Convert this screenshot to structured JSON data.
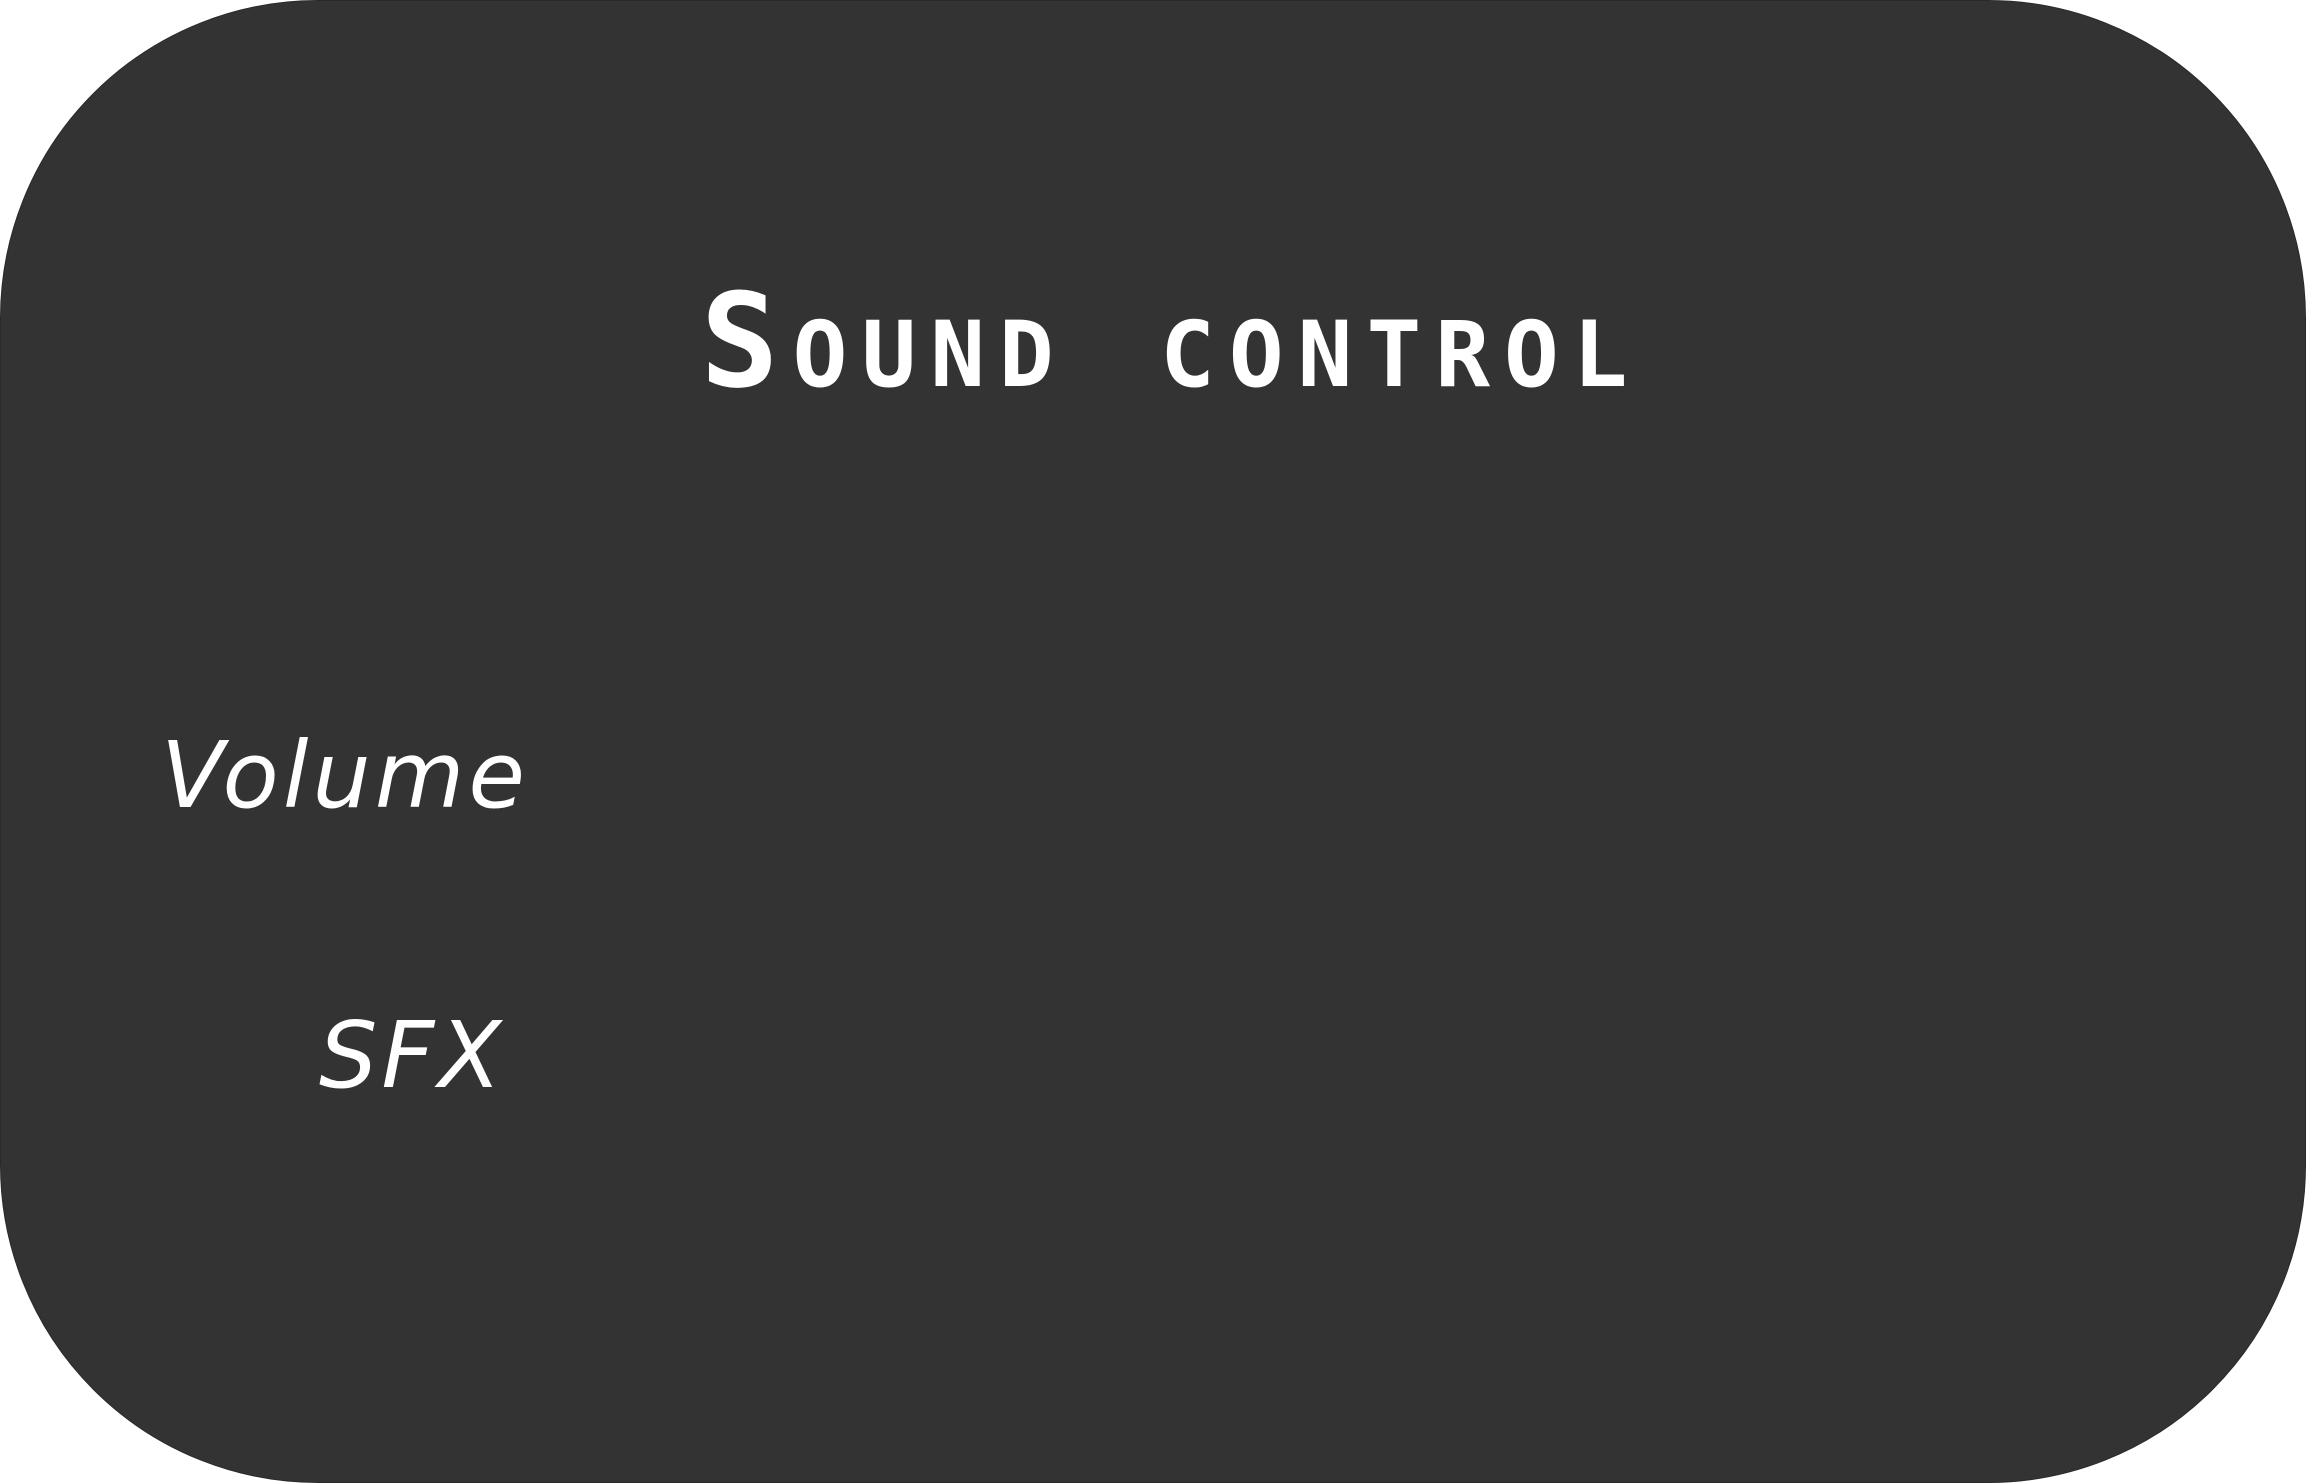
{
  "menu": {
    "title": "Sound control",
    "settings": [
      {
        "label": "Volume"
      },
      {
        "label": "SFX"
      }
    ]
  },
  "colors": {
    "panel_background": "#333333",
    "text": "#ffffff",
    "page_background": "#ffffff"
  }
}
